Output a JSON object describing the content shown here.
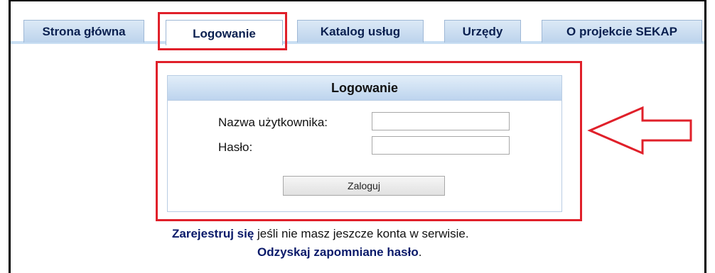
{
  "tabs": [
    {
      "label": "Strona główna",
      "active": false
    },
    {
      "label": "Logowanie",
      "active": true
    },
    {
      "label": "Katalog usług",
      "active": false
    },
    {
      "label": "Urzędy",
      "active": false
    },
    {
      "label": "O projekcie SEKAP",
      "active": false
    }
  ],
  "login": {
    "title": "Logowanie",
    "username_label": "Nazwa użytkownika:",
    "username_value": "",
    "password_label": "Hasło:",
    "password_value": "",
    "submit_label": "Zaloguj"
  },
  "footer": {
    "register_link": "Zarejestruj się",
    "register_text": " jeśli nie masz jeszcze konta w serwisie.",
    "recover_link": "Odzyskaj zapomniane hasło",
    "recover_suffix": "."
  },
  "colors": {
    "highlight_red": "#e0202a",
    "tab_text": "#0a2050",
    "link": "#0a1a6a"
  }
}
